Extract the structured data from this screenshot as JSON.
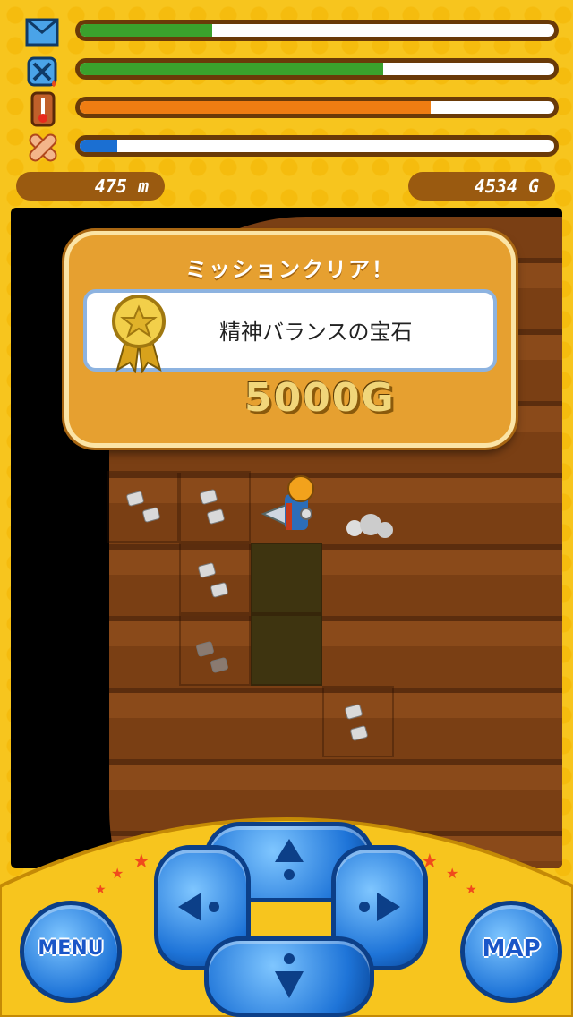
{
  "hud": {
    "depth": "475 m",
    "gold": "4534 G",
    "gauges": [
      {
        "icon": "supply-crate-icon",
        "fill": 0.28,
        "color": "#3aa12c"
      },
      {
        "icon": "fuel-can-icon",
        "fill": 0.64,
        "color": "#3aa12c"
      },
      {
        "icon": "thermometer-icon",
        "fill": 0.74,
        "color": "#ef7d12"
      },
      {
        "icon": "bandage-icon",
        "fill": 0.08,
        "color": "#1b6fd2"
      }
    ]
  },
  "mission": {
    "title": "ミッションクリア！",
    "name": "精神バランスの宝石",
    "reward": "5000G"
  },
  "controls": {
    "menu_label": "MENU",
    "map_label": "MAP",
    "dpad": [
      "up",
      "left",
      "right",
      "down"
    ]
  }
}
